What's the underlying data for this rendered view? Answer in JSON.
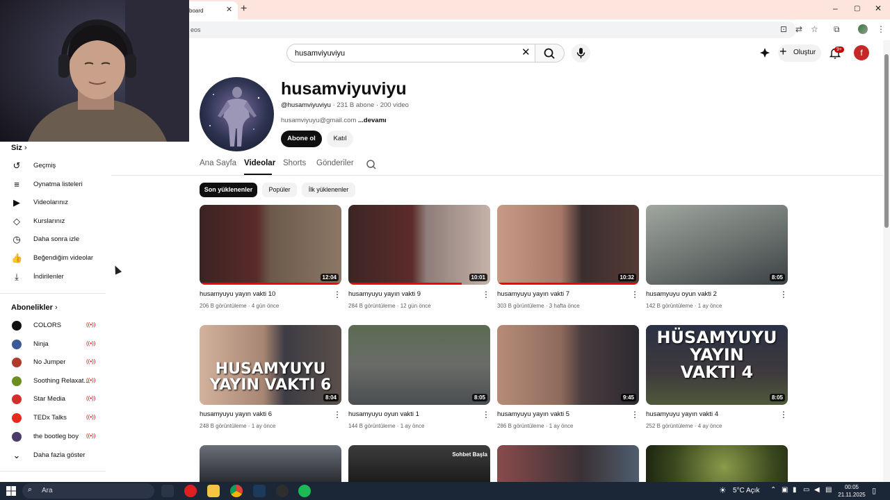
{
  "browser": {
    "tab_title": "board",
    "address": "eos",
    "window_buttons": [
      "–",
      "▢",
      "✕"
    ]
  },
  "header": {
    "search_query": "husamviyuviyu",
    "create_label": "Oluştur",
    "notifications_badge": "9+",
    "account_initial": "f"
  },
  "channel": {
    "name": "husamviyuviyu",
    "handle": "@husamviyuviyu",
    "stats": "· 231 B abone · 200 video",
    "email": "husamviyuyu@gmail.com",
    "more": "...devamı",
    "subscribe_label": "Abone ol",
    "join_label": "Katıl"
  },
  "tabs": [
    "Ana Sayfa",
    "Videolar",
    "Shorts",
    "Gönderiler"
  ],
  "active_tab": "Videolar",
  "chips": [
    "Son yüklenenler",
    "Popüler",
    "İlk yüklenenler"
  ],
  "videos": [
    {
      "title": "husamyuyu yayın vakti 10",
      "views": "206 B görüntüleme",
      "age": "4 gün önce",
      "duration": "12:04",
      "progress": 1.0
    },
    {
      "title": "husamyuyu yayın vakti 9",
      "views": "284 B görüntüleme",
      "age": "12 gün önce",
      "duration": "10:01",
      "progress": 0.8
    },
    {
      "title": "husamyuyu yayın vakti 7",
      "views": "303 B görüntüleme",
      "age": "3 hafta önce",
      "duration": "10:32",
      "progress": 1.0
    },
    {
      "title": "husamyuyu oyun vakti 2",
      "views": "142 B görüntüleme",
      "age": "1 ay önce",
      "duration": "8:05",
      "progress": 0
    },
    {
      "title": "husamyuyu yayın vakti 6",
      "views": "248 B görüntüleme",
      "age": "1 ay önce",
      "duration": "8:04",
      "progress": 0,
      "overlay": "HUSAMYUYU\nYAYIN VAKTI 6"
    },
    {
      "title": "husamyuyu oyun vakti 1",
      "views": "144 B görüntüleme",
      "age": "1 ay önce",
      "duration": "8:05",
      "progress": 0
    },
    {
      "title": "husamyuyu yayın vakti 5",
      "views": "286 B görüntüleme",
      "age": "1 ay önce",
      "duration": "9:45",
      "progress": 0
    },
    {
      "title": "husamyuyu yayın vakti 4",
      "views": "252 B görüntüleme",
      "age": "4 ay önce",
      "duration": "8:05",
      "progress": 0,
      "overlay": "HÜSAMYUYU\nYAYIN\nVAKTI 4"
    }
  ],
  "third_row_overlay": "Sohbet Başla",
  "sidebar": {
    "you_header": "Siz",
    "you_items": [
      {
        "label": "Geçmiş",
        "icon": "history-icon",
        "glyph": "↺"
      },
      {
        "label": "Oynatma listeleri",
        "icon": "playlists-icon",
        "glyph": "≡"
      },
      {
        "label": "Videolarınız",
        "icon": "your-videos-icon",
        "glyph": "▶"
      },
      {
        "label": "Kurslarınız",
        "icon": "courses-icon",
        "glyph": "◇"
      },
      {
        "label": "Daha sonra izle",
        "icon": "watch-later-icon",
        "glyph": "◷"
      },
      {
        "label": "Beğendiğim videolar",
        "icon": "like-icon",
        "glyph": "👍"
      },
      {
        "label": "İndirilenler",
        "icon": "download-icon",
        "glyph": "⤓"
      }
    ],
    "subs_header": "Abonelikler",
    "subscriptions": [
      {
        "label": "COLORS",
        "color": "#111111"
      },
      {
        "label": "Ninja",
        "color": "#3b5998"
      },
      {
        "label": "No Jumper",
        "color": "#b23a2a"
      },
      {
        "label": "Soothing Relaxat...",
        "color": "#6b8e23"
      },
      {
        "label": "Star Media",
        "color": "#d32f2f"
      },
      {
        "label": "TEDx Talks",
        "color": "#e62b1e"
      },
      {
        "label": "the bootleg boy",
        "color": "#4a3b6b"
      }
    ],
    "show_more": "Daha fazla göster"
  },
  "taskbar": {
    "search": "Ara",
    "weather": "5°C  Açık",
    "time": "00:05",
    "date": "21.11.2025"
  }
}
